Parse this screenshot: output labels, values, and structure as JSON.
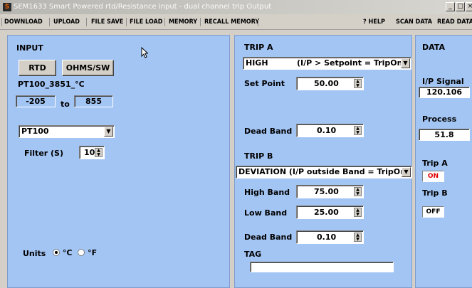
{
  "window": {
    "title": "SEM1633 Smart Powered rtd/Resistance input - dual channel trip Output",
    "icon_letter": "S",
    "controls": {
      "minimize": "_",
      "maximize": "□",
      "close": "×"
    }
  },
  "menu": {
    "items": [
      "DOWNLOAD",
      "UPLOAD",
      "FILE SAVE",
      "FILE LOAD",
      "MEMORY",
      "RECALL MEMORY"
    ],
    "right_items": [
      "? HELP",
      "SCAN DATA",
      "READ DATA"
    ]
  },
  "input": {
    "title": "INPUT",
    "rtd_button": "RTD",
    "ohms_button": "OHMS/SW",
    "sensor_label": "PT100_3851_°C",
    "range_low": "-205",
    "range_to": "to",
    "range_high": "855",
    "sensor_select": "PT100",
    "filter_label": "Filter (S)",
    "filter_value": "10",
    "units_label": "Units",
    "unit_c": "°C",
    "unit_f": "°F",
    "unit_selected": "C"
  },
  "trip_a": {
    "title": "TRIP A",
    "mode_select": "HIGH",
    "mode_desc": "(I/P > Setpoint = TripOn)",
    "setpoint_label": "Set Point",
    "setpoint_value": "50.00",
    "deadband_label": "Dead Band",
    "deadband_value": "0.10"
  },
  "trip_b": {
    "title": "TRIP B",
    "mode_select": "DEVIATION  (I/P outside Band = TripOn)",
    "high_band_label": "High Band",
    "high_band_value": "75.00",
    "low_band_label": "Low Band",
    "low_band_value": "25.00",
    "deadband_label": "Dead Band",
    "deadband_value": "0.10",
    "tag_label": "TAG",
    "tag_value": ""
  },
  "data": {
    "title": "DATA",
    "ip_signal_label": "I/P Signal",
    "ip_signal_value": "120.106",
    "process_label": "Process",
    "process_value": "51.8",
    "trip_a_label": "Trip A",
    "trip_a_state": "ON",
    "trip_b_label": "Trip B",
    "trip_b_state": "OFF",
    "on_color": "#e00000"
  }
}
